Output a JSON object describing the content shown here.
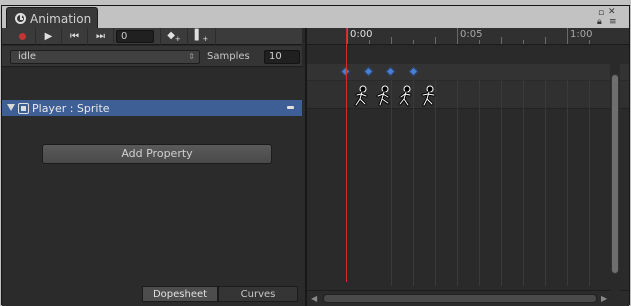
{
  "window": {
    "tab_title": "Animation",
    "tab_icon": "clock-icon",
    "controls": [
      "maximize-icon",
      "close-icon",
      "lock-icon",
      "menu-icon"
    ]
  },
  "toolbar": {
    "buttons": [
      "record-button",
      "play-button",
      "prev-key-button",
      "next-key-button"
    ],
    "frame_value": "0",
    "add_keyframe_icon": "add-keyframe-icon",
    "add_event_icon": "add-event-icon"
  },
  "clip": {
    "selected": "idle",
    "samples_label": "Samples",
    "samples_value": "10"
  },
  "property": {
    "label": "Player : Sprite"
  },
  "add_property_label": "Add Property",
  "bottom_tabs": {
    "dopesheet": "Dopesheet",
    "curves": "Curves",
    "active": "Dopesheet"
  },
  "ruler": {
    "labels": [
      "0:00",
      "0:05",
      "1:00"
    ]
  },
  "keyframes": {
    "count": 4
  },
  "colors": {
    "selection": "#3e5f96",
    "playhead": "#d42c2c",
    "keyframe": "#4a7fd0",
    "record": "#c03535"
  }
}
